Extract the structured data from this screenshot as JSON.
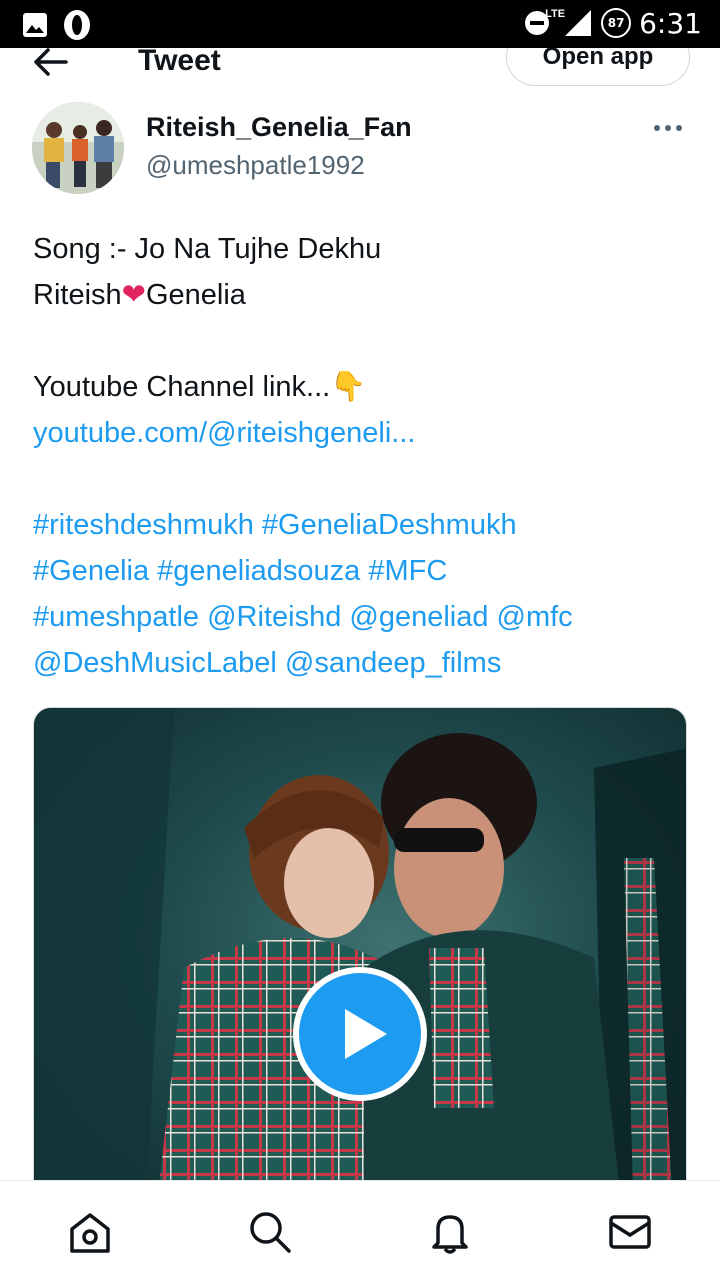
{
  "status_bar": {
    "time": "6:31",
    "battery": "87",
    "network": "LTE"
  },
  "header": {
    "title": "Tweet",
    "open_app_label": "Open app"
  },
  "tweet": {
    "author": {
      "display_name": "Riteish_Genelia_Fan",
      "handle": "@umeshpatle1992"
    },
    "lines": {
      "song": "Song :- Jo Na Tujhe Dekhu",
      "name_left": "Riteish",
      "heart": "❤",
      "name_right": "Genelia",
      "channel_text": "Youtube Channel link...",
      "pointer": "👇",
      "link": "youtube.com/@riteishgeneli...",
      "hashtags_line1": "#riteshdeshmukh #GeneliaDeshmukh",
      "hashtags_line2": "#Genelia #geneliadsouza #MFC",
      "hashtags_line3": "#umeshpatle @Riteishd @geneliad @mfc",
      "hashtags_line4": "@DeshMusicLabel @sandeep_films"
    }
  },
  "icons": {
    "status_left": [
      "image-icon",
      "opera-icon"
    ],
    "status_right": [
      "dnd-icon",
      "signal-icon",
      "battery-icon"
    ],
    "nav": [
      "home-icon",
      "search-icon",
      "bell-icon",
      "mail-icon"
    ]
  },
  "colors": {
    "link": "#1d9bf0",
    "text": "#0f1419",
    "secondary": "#536471",
    "play_button": "#1d9bf0"
  }
}
